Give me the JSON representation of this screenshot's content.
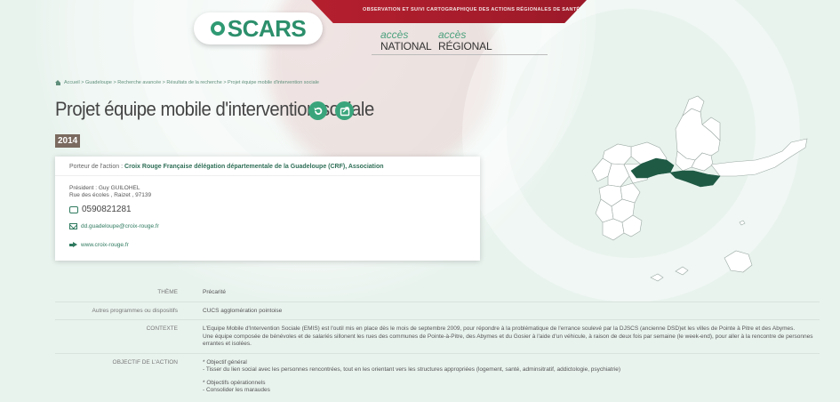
{
  "header": {
    "tagline": "Observation et suivi cartographique des actions régionales de santé",
    "logo_text": "SCARS",
    "access_national": {
      "small": "accès",
      "large": "NATIONAL"
    },
    "access_regional": {
      "small": "accès",
      "large": "RÉGIONAL"
    }
  },
  "breadcrumb": "Accueil > Guadeloupe > Recherche avancée > Résultats de la recherche > Projet équipe mobile d'intervention sociale",
  "page": {
    "title": "Projet équipe mobile d'intervention sociale",
    "year": "2014"
  },
  "card": {
    "porteur_label": "Porteur de l'action : ",
    "porteur_org": "Croix Rouge Française délégation départementale de la Guadeloupe (CRF), Association",
    "president": "Président : Guy GUILOHEL",
    "address": "Rue des écoles , Raizet , 97139",
    "phone": "0590821281",
    "email": "dd.guadeloupe@croix-rouge.fr",
    "website": "www.croix-rouge.fr"
  },
  "details": {
    "theme_label": "THÈME",
    "theme_value": "Précarité",
    "autres_label": "Autres programmes ou dispositifs",
    "autres_value": "CUCS agglomération pointoise",
    "contexte_label": "CONTEXTE",
    "contexte_p1": "L'Equipe Mobile d'Intervention Sociale (EMIS) est l'outil mis en place dès le mois de septembre 2009, pour répondre à la problématique de l'errance soulevé par la DJSCS (ancienne DSD)et les villes de Pointe à Pitre et des Abymes.",
    "contexte_p2": "Une équipe composée de bénévoles et de salariés sillonent les rues des communes de Pointe-à-Pitre, des Abymes et du Gosier à l'aide d'un véhicule, à raison de deux fois par semaine (le week-end), pour aller à la rencontre de personnes errantes et isolées.",
    "objectif_label": "OBJECTIF DE L'ACTION",
    "objectif_l1": "* Objectif général",
    "objectif_l2": "- Tisser du lien social avec les personnes rencontrées, tout en les orientant vers les structures appropriées (logement, santé, adminsitratif, addictologie, psychiatrie)",
    "objectif_l3": "* Objectifs opérationnels",
    "objectif_l4": "- Consolider les maraudes"
  },
  "colors": {
    "accent_green": "#3aa57c",
    "brand_red": "#b51f2e",
    "map_highlight": "#1f5a45"
  }
}
